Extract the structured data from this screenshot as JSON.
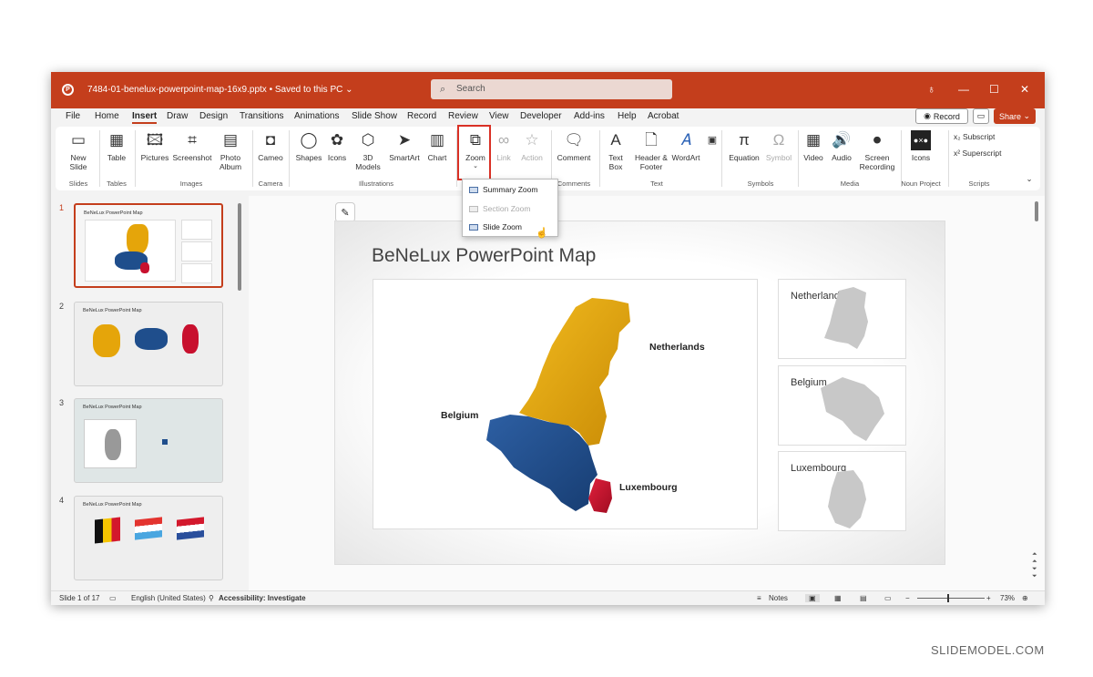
{
  "window": {
    "filename": "7484-01-benelux-powerpoint-map-16x9.pptx",
    "save_status": "• Saved to this PC ⌄",
    "search_placeholder": "Search",
    "accent": "#c43e1c"
  },
  "menu": {
    "tabs": [
      "File",
      "Home",
      "Insert",
      "Draw",
      "Design",
      "Transitions",
      "Animations",
      "Slide Show",
      "Record",
      "Review",
      "View",
      "Developer",
      "Add-ins",
      "Help",
      "Acrobat"
    ],
    "active": "Insert",
    "record_label": "Record",
    "share_label": "Share"
  },
  "ribbon": {
    "new_slide": "New Slide",
    "table": "Table",
    "pictures": "Pictures",
    "screenshot": "Screenshot",
    "photo_album": "Photo Album",
    "cameo": "Cameo",
    "shapes": "Shapes",
    "icons": "Icons",
    "models_3d": "3D Models",
    "smartart": "SmartArt",
    "chart": "Chart",
    "zoom": "Zoom",
    "link": "Link",
    "action": "Action",
    "comment": "Comment",
    "text_box": "Text Box",
    "header_footer": "Header & Footer",
    "wordart": "WordArt",
    "equation": "Equation",
    "symbol": "Symbol",
    "video": "Video",
    "audio": "Audio",
    "screen_recording": "Screen Recording",
    "noun_icons": "Icons",
    "subscript": "Subscript",
    "superscript": "Superscript",
    "groups": {
      "slides": "Slides",
      "tables": "Tables",
      "images": "Images",
      "camera": "Camera",
      "illustrations": "Illustrations",
      "comments": "Comments",
      "text": "Text",
      "symbols": "Symbols",
      "media": "Media",
      "noun_project": "Noun Project",
      "scripts": "Scripts"
    }
  },
  "zoom_menu": {
    "items": [
      "Summary Zoom",
      "Section Zoom",
      "Slide Zoom"
    ]
  },
  "thumbnails": [
    {
      "num": "1",
      "title": "BeNeLux PowerPoint Map"
    },
    {
      "num": "2",
      "title": "BeNeLux PowerPoint Map"
    },
    {
      "num": "3",
      "title": "BeNeLux PowerPoint Map"
    },
    {
      "num": "4",
      "title": "BeNeLux PowerPoint Map"
    }
  ],
  "slide": {
    "title": "BeNeLux PowerPoint Map",
    "labels": {
      "netherlands": "Netherlands",
      "belgium": "Belgium",
      "luxembourg": "Luxembourg"
    },
    "side_boxes": [
      "Netherlands",
      "Belgium",
      "Luxembourg"
    ],
    "colors": {
      "netherlands": "#e5a50a",
      "belgium": "#1f4e8c",
      "luxembourg": "#c8102e",
      "grey": "#c8c8c8"
    }
  },
  "status": {
    "slide": "Slide 1 of 17",
    "language": "English (United States)",
    "accessibility": "Accessibility: Investigate",
    "notes": "Notes",
    "zoom": "73%"
  },
  "watermark": "SLIDEMODEL.COM"
}
